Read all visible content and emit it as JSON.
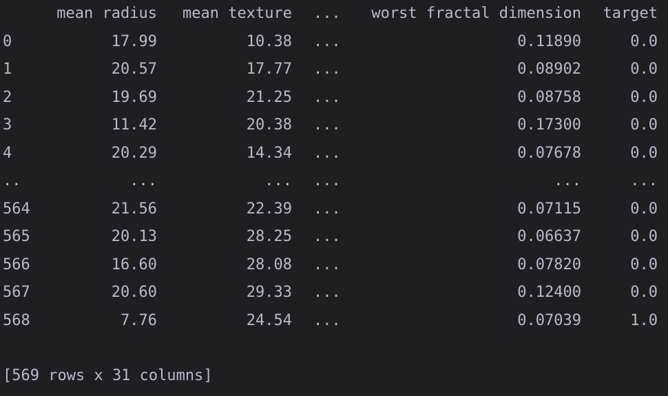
{
  "columns": {
    "index": "",
    "mean_radius": "mean radius",
    "mean_texture": "mean texture",
    "ellipsis": "...",
    "worst_fractal_dimension": "worst fractal dimension",
    "target": "target"
  },
  "rows": [
    {
      "index": "0",
      "mean_radius": "17.99",
      "mean_texture": "10.38",
      "ellipsis": "...",
      "worst_fractal_dimension": "0.11890",
      "target": "0.0"
    },
    {
      "index": "1",
      "mean_radius": "20.57",
      "mean_texture": "17.77",
      "ellipsis": "...",
      "worst_fractal_dimension": "0.08902",
      "target": "0.0"
    },
    {
      "index": "2",
      "mean_radius": "19.69",
      "mean_texture": "21.25",
      "ellipsis": "...",
      "worst_fractal_dimension": "0.08758",
      "target": "0.0"
    },
    {
      "index": "3",
      "mean_radius": "11.42",
      "mean_texture": "20.38",
      "ellipsis": "...",
      "worst_fractal_dimension": "0.17300",
      "target": "0.0"
    },
    {
      "index": "4",
      "mean_radius": "20.29",
      "mean_texture": "14.34",
      "ellipsis": "...",
      "worst_fractal_dimension": "0.07678",
      "target": "0.0"
    },
    {
      "index": "..",
      "mean_radius": "...",
      "mean_texture": "...",
      "ellipsis": "...",
      "worst_fractal_dimension": "...",
      "target": "..."
    },
    {
      "index": "564",
      "mean_radius": "21.56",
      "mean_texture": "22.39",
      "ellipsis": "...",
      "worst_fractal_dimension": "0.07115",
      "target": "0.0"
    },
    {
      "index": "565",
      "mean_radius": "20.13",
      "mean_texture": "28.25",
      "ellipsis": "...",
      "worst_fractal_dimension": "0.06637",
      "target": "0.0"
    },
    {
      "index": "566",
      "mean_radius": "16.60",
      "mean_texture": "28.08",
      "ellipsis": "...",
      "worst_fractal_dimension": "0.07820",
      "target": "0.0"
    },
    {
      "index": "567",
      "mean_radius": "20.60",
      "mean_texture": "29.33",
      "ellipsis": "...",
      "worst_fractal_dimension": "0.12400",
      "target": "0.0"
    },
    {
      "index": "568",
      "mean_radius": "7.76",
      "mean_texture": "24.54",
      "ellipsis": "...",
      "worst_fractal_dimension": "0.07039",
      "target": "1.0"
    }
  ],
  "footer": "[569 rows x 31 columns]"
}
